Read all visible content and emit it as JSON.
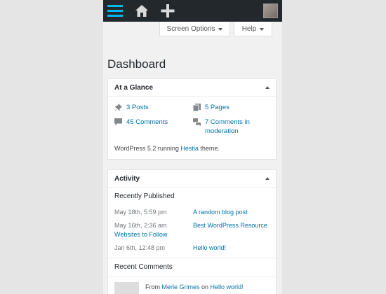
{
  "colors": {
    "adminbar": "#23282d",
    "menu_accent": "#00b9eb",
    "link": "#0073aa",
    "background": "#f1f1f1"
  },
  "adminbar": {
    "icons": [
      "menu-icon",
      "home-icon",
      "plus-icon",
      "avatar"
    ]
  },
  "screen_meta": {
    "screen_options_label": "Screen Options",
    "help_label": "Help"
  },
  "page": {
    "title": "Dashboard"
  },
  "at_a_glance": {
    "title": "At a Glance",
    "items": [
      {
        "icon": "pin-icon",
        "label": "3 Posts"
      },
      {
        "icon": "pages-icon",
        "label": "5 Pages"
      },
      {
        "icon": "comment-icon",
        "label": "45 Comments"
      },
      {
        "icon": "comments-icon",
        "label_line1": "7 Comments in",
        "label_line2": "moderation"
      }
    ],
    "info_prefix": "WordPress 5.2 running ",
    "theme": "Hestia",
    "info_suffix": " theme."
  },
  "activity": {
    "title": "Activity",
    "recently_published_title": "Recently Published",
    "posts": [
      {
        "date": "May 18th, 5:59 pm",
        "title": "A random blog post"
      },
      {
        "date": "May 16th, 2:36 am",
        "title_line1": "Best WordPress Resource",
        "title_line2": "Websites to Follow"
      },
      {
        "date": "Jan 6th, 12:48 pm",
        "title": "Hello world!"
      }
    ],
    "recent_comments_title": "Recent Comments",
    "comment": {
      "from": "From ",
      "author": "Merle Grimes",
      "on": " on ",
      "post": "Hello world!"
    }
  }
}
